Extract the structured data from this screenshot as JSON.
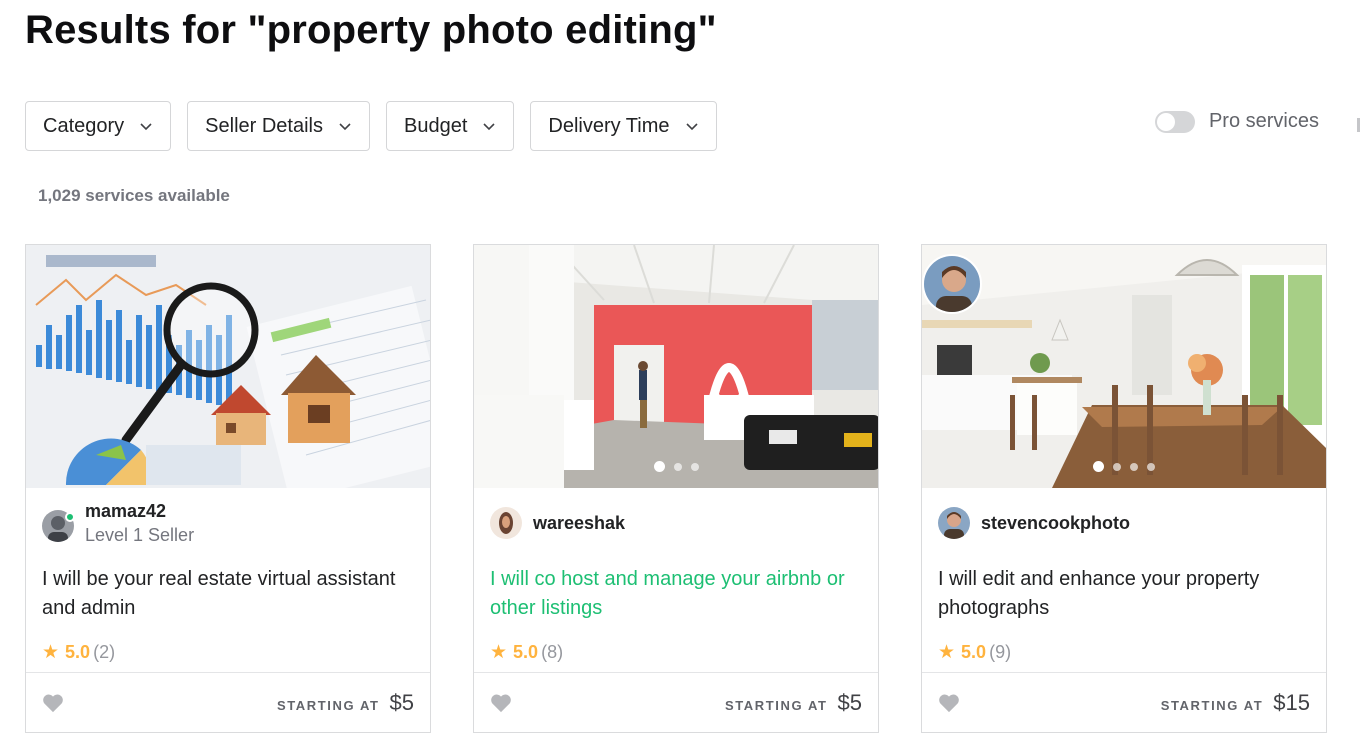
{
  "page": {
    "title": "Results for \"property photo editing\"",
    "services_count": "1,029 services available"
  },
  "filters": [
    {
      "label": "Category"
    },
    {
      "label": "Seller Details"
    },
    {
      "label": "Budget"
    },
    {
      "label": "Delivery Time"
    }
  ],
  "pro_services": {
    "label": "Pro services",
    "enabled": false
  },
  "cards": [
    {
      "seller_name": "mamaz42",
      "seller_level": "Level 1 Seller",
      "online": true,
      "title": "I will be your real estate virtual assistant and admin",
      "rating": "5.0",
      "reviews": "(2)",
      "starting_label": "STARTING AT",
      "price": "$5",
      "image_dots": 0
    },
    {
      "seller_name": "wareeshak",
      "seller_level": "",
      "online": false,
      "title": "I will co host and manage your airbnb or other listings",
      "rating": "5.0",
      "reviews": "(8)",
      "starting_label": "STARTING AT",
      "price": "$5",
      "image_dots": 3
    },
    {
      "seller_name": "stevencookphoto",
      "seller_level": "",
      "online": false,
      "title": "I will edit and enhance your property photographs",
      "rating": "5.0",
      "reviews": "(9)",
      "starting_label": "STARTING AT",
      "price": "$15",
      "image_dots": 4
    }
  ],
  "icons": {
    "chevron": "chevron-down-icon",
    "star": "star-icon",
    "heart": "heart-icon"
  },
  "colors": {
    "accent_green": "#1dbf73",
    "star_yellow": "#ffb33e",
    "heart_gray": "#b5b6ba",
    "border": "#dadbdd"
  }
}
